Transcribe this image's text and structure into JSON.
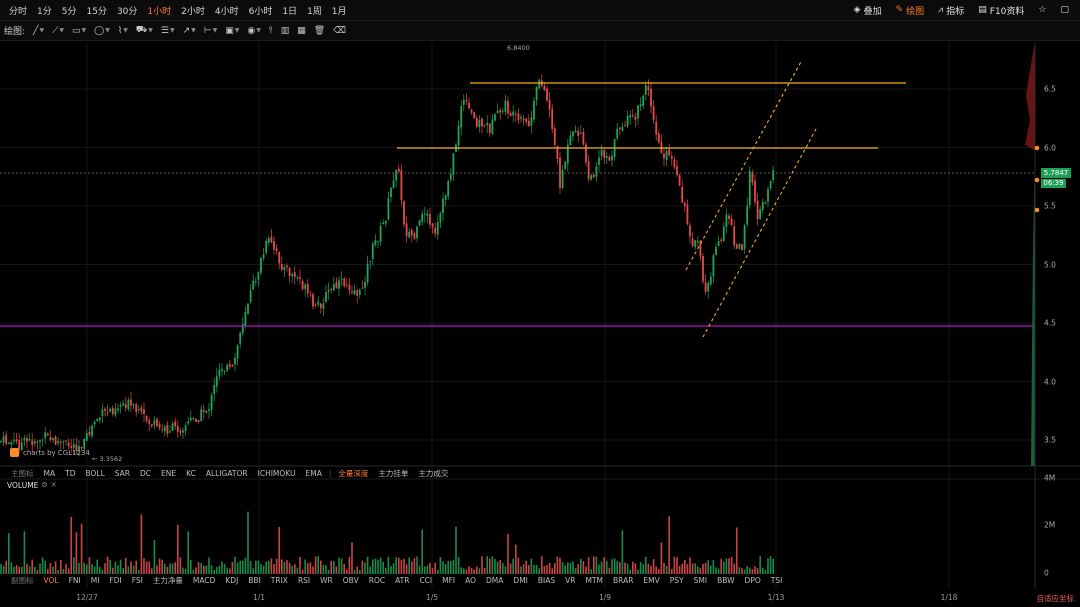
{
  "timeframes": [
    "分时",
    "1分",
    "5分",
    "15分",
    "30分",
    "1小时",
    "2小时",
    "4小时",
    "6小时",
    "1日",
    "1周",
    "1月"
  ],
  "timeframe_active": "1小时",
  "right_tools": {
    "overlay": "叠加",
    "draw": "绘图",
    "indicators": "指标",
    "f10": "F10资料"
  },
  "draw_label": "绘图:",
  "price_axis": {
    "ticks": [
      "6.5",
      "6.0",
      "5.5",
      "5.0",
      "4.5",
      "4.0",
      "3.5"
    ],
    "last_price": "5.7847",
    "countdown": "06:39"
  },
  "high_label": "6.8400",
  "low_label": "3.3562",
  "watermark": "charts by CGL1234",
  "main_indicators": [
    "主图标",
    "MA",
    "TD",
    "BOLL",
    "SAR",
    "DC",
    "ENE",
    "KC",
    "ALLIGATOR",
    "ICHIMOKU",
    "EMA",
    "|",
    "全量深度",
    "主力挂单",
    "主力成交"
  ],
  "main_indicator_active": "全量深度",
  "volume_label": "VOLUME",
  "volume_ticks": [
    "4M",
    "2M",
    "0"
  ],
  "sub_indicators": [
    "副图标",
    "VOL",
    "FNI",
    "MI",
    "FDI",
    "FSI",
    "主力净量",
    "MACD",
    "KDJ",
    "BBI",
    "TRIX",
    "RSI",
    "WR",
    "OBV",
    "ROC",
    "ATR",
    "CCI",
    "MFI",
    "AO",
    "DMA",
    "DMI",
    "BIAS",
    "VR",
    "MTM",
    "BRAR",
    "EMV",
    "PSY",
    "SMI",
    "BBW",
    "DPO",
    "TSI"
  ],
  "sub_indicator_active": "VOL",
  "dates": [
    "12/27",
    "1/1",
    "1/5",
    "1/9",
    "1/13",
    "1/18"
  ],
  "autoscale": "自适应坐标",
  "colors": {
    "up": "#1fa65a",
    "down": "#e84a4a",
    "accent": "#ff7a2f",
    "support": "#b414c8",
    "resistance": "#f0b020"
  }
}
